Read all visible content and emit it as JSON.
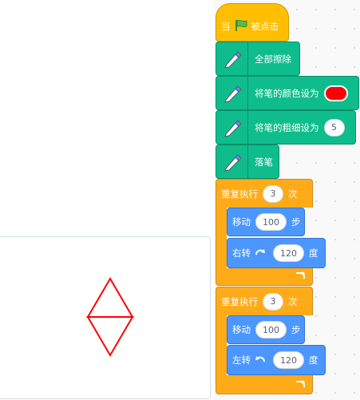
{
  "script": {
    "hat": {
      "prefix": "当",
      "suffix": "被点击",
      "icon": "green-flag-icon"
    },
    "erase_all": {
      "label": "全部擦除"
    },
    "set_pen_color": {
      "label": "将笔的颜色设为",
      "color": "#ff0000"
    },
    "set_pen_size": {
      "label": "将笔的粗细设为",
      "value": "5"
    },
    "pen_down": {
      "label": "落笔"
    },
    "loop1": {
      "label": "重复执行",
      "times": "3",
      "times_suffix": "次",
      "move": {
        "label": "移动",
        "steps": "100",
        "suffix": "步"
      },
      "turn": {
        "label": "右转",
        "icon": "rotate-clockwise-icon",
        "degrees": "120",
        "suffix": "度"
      }
    },
    "loop2": {
      "label": "重复执行",
      "times": "3",
      "times_suffix": "次",
      "move": {
        "label": "移动",
        "steps": "100",
        "suffix": "步"
      },
      "turn": {
        "label": "左转",
        "icon": "rotate-counterclockwise-icon",
        "degrees": "120",
        "suffix": "度"
      }
    }
  },
  "colors": {
    "events": "#ffbf00",
    "pen": "#0fbd8c",
    "control": "#ffab19",
    "motion": "#4c97ff",
    "drawing": "#ff0000"
  }
}
